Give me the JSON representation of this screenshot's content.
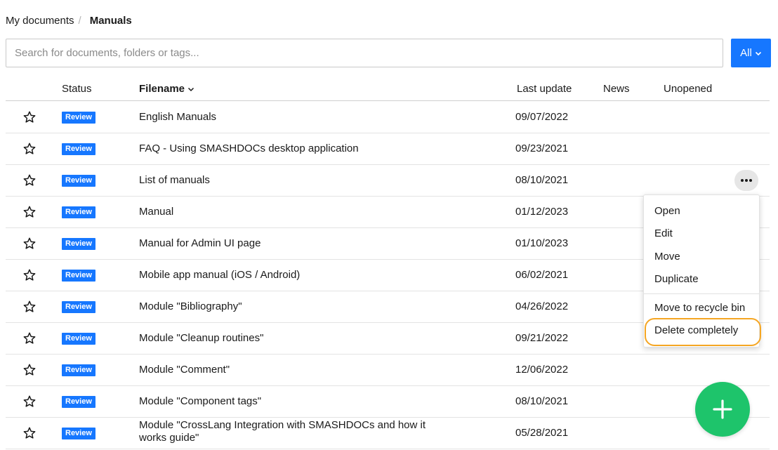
{
  "breadcrumb": {
    "root": "My documents",
    "separator": "/",
    "current": "Manuals"
  },
  "search": {
    "value": "",
    "placeholder": "Search for documents, folders or tags..."
  },
  "filter": {
    "label": "All",
    "icon": "chevron-down-icon"
  },
  "table": {
    "headers": {
      "status": "Status",
      "filename": "Filename",
      "last_update": "Last update",
      "news": "News",
      "unopened": "Unopened"
    },
    "rows": [
      {
        "status": "Review",
        "filename": "English Manuals",
        "last_update": "09/07/2022"
      },
      {
        "status": "Review",
        "filename": "FAQ - Using SMASHDOCs desktop application",
        "last_update": "09/23/2021"
      },
      {
        "status": "Review",
        "filename": "List of manuals",
        "last_update": "08/10/2021"
      },
      {
        "status": "Review",
        "filename": "Manual",
        "last_update": "01/12/2023"
      },
      {
        "status": "Review",
        "filename": "Manual for Admin UI page",
        "last_update": "01/10/2023"
      },
      {
        "status": "Review",
        "filename": "Mobile app manual (iOS / Android)",
        "last_update": "06/02/2021"
      },
      {
        "status": "Review",
        "filename": "Module \"Bibliography\"",
        "last_update": "04/26/2022"
      },
      {
        "status": "Review",
        "filename": "Module \"Cleanup routines\"",
        "last_update": "09/21/2022"
      },
      {
        "status": "Review",
        "filename": "Module \"Comment\"",
        "last_update": "12/06/2022"
      },
      {
        "status": "Review",
        "filename": "Module \"Component tags\"",
        "last_update": "08/10/2021"
      },
      {
        "status": "Review",
        "filename": "Module \"CrossLang Integration with SMASHDOCs and how it works guide\"",
        "last_update": "05/28/2021"
      }
    ]
  },
  "context_menu": {
    "items": [
      "Open",
      "Edit",
      "Move",
      "Duplicate",
      "Move to recycle bin",
      "Delete completely"
    ],
    "highlighted": "Delete completely"
  },
  "colors": {
    "accent": "#1677ff",
    "fab": "#1ec46b",
    "highlight": "#f5a623"
  },
  "icons": {
    "star": "star-outline-icon",
    "more": "more-horizontal-icon",
    "fab": "plus-icon"
  }
}
